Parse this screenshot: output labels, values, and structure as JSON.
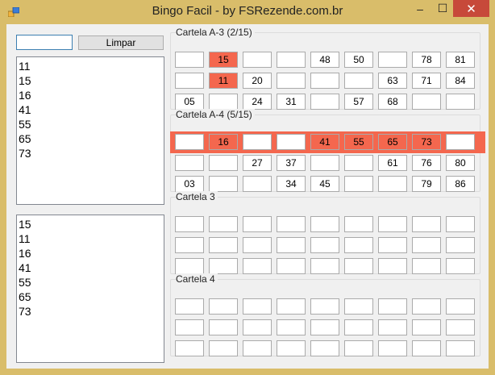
{
  "window": {
    "title": "Bingo Facil - by FSRezende.com.br",
    "minimize": "–",
    "maximize": "☐",
    "close": "✕"
  },
  "controls": {
    "input_value": "",
    "clear_button": "Limpar"
  },
  "list_top": [
    "11",
    "15",
    "16",
    "41",
    "55",
    "65",
    "73"
  ],
  "list_bottom": [
    "15",
    "11",
    "16",
    "41",
    "55",
    "65",
    "73"
  ],
  "cards": [
    {
      "label": "Cartela A-3 (2/15)",
      "highlight_row": -1,
      "rows": [
        [
          "",
          "15",
          "",
          "",
          "48",
          "50",
          "",
          "78",
          "81"
        ],
        [
          "",
          "11",
          "20",
          "",
          "",
          "",
          "63",
          "71",
          "84"
        ],
        [
          "05",
          "",
          "24",
          "31",
          "",
          "57",
          "68",
          "",
          ""
        ]
      ],
      "hits": [
        [
          0,
          1
        ],
        [
          1,
          1
        ]
      ]
    },
    {
      "label": "Cartela A-4 (5/15)",
      "highlight_row": 0,
      "rows": [
        [
          "",
          "16",
          "",
          "",
          "41",
          "55",
          "65",
          "73",
          ""
        ],
        [
          "",
          "",
          "27",
          "37",
          "",
          "",
          "61",
          "76",
          "80"
        ],
        [
          "03",
          "",
          "",
          "34",
          "45",
          "",
          "",
          "79",
          "86"
        ]
      ],
      "hits": [
        [
          0,
          1
        ],
        [
          0,
          4
        ],
        [
          0,
          5
        ],
        [
          0,
          6
        ],
        [
          0,
          7
        ]
      ]
    },
    {
      "label": "Cartela 3",
      "highlight_row": -1,
      "rows": [
        [
          "",
          "",
          "",
          "",
          "",
          "",
          "",
          "",
          ""
        ],
        [
          "",
          "",
          "",
          "",
          "",
          "",
          "",
          "",
          ""
        ],
        [
          "",
          "",
          "",
          "",
          "",
          "",
          "",
          "",
          ""
        ]
      ],
      "hits": []
    },
    {
      "label": "Cartela 4",
      "highlight_row": -1,
      "rows": [
        [
          "",
          "",
          "",
          "",
          "",
          "",
          "",
          "",
          ""
        ],
        [
          "",
          "",
          "",
          "",
          "",
          "",
          "",
          "",
          ""
        ],
        [
          "",
          "",
          "",
          "",
          "",
          "",
          "",
          "",
          ""
        ]
      ],
      "hits": []
    }
  ],
  "colors": {
    "hit": "#f4674e",
    "frame": "#d9bd6a",
    "close": "#c7493a"
  }
}
